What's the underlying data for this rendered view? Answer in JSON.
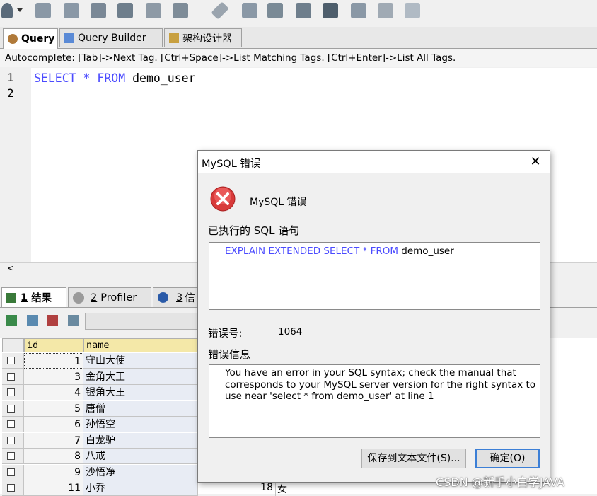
{
  "tabs": [
    {
      "label": "Query",
      "active": true
    },
    {
      "label": "Query Builder",
      "active": false
    },
    {
      "label": "架构设计器",
      "active": false
    }
  ],
  "autocomplete_hint": "Autocomplete: [Tab]->Next Tag. [Ctrl+Space]->List Matching Tags. [Ctrl+Enter]->List All Tags.",
  "editor": {
    "line_numbers": [
      "1",
      "2"
    ],
    "code": {
      "kw1": "SELECT",
      "star": "*",
      "kw2": "FROM",
      "table": "demo_user"
    }
  },
  "result_tabs": [
    {
      "num": "1",
      "label": "结果"
    },
    {
      "num": "2",
      "label": "Profiler"
    },
    {
      "num": "3",
      "label": "信"
    }
  ],
  "grid": {
    "columns": [
      "id",
      "name"
    ],
    "rows": [
      {
        "id": "1",
        "name": "守山大使"
      },
      {
        "id": "3",
        "name": "金角大王"
      },
      {
        "id": "4",
        "name": "银角大王"
      },
      {
        "id": "5",
        "name": "唐僧"
      },
      {
        "id": "6",
        "name": "孙悟空"
      },
      {
        "id": "7",
        "name": "白龙驴"
      },
      {
        "id": "8",
        "name": "八戒"
      },
      {
        "id": "9",
        "name": "沙悟净"
      },
      {
        "id": "11",
        "name": "小乔"
      }
    ],
    "partial_row": {
      "age": "18",
      "sex": "女"
    }
  },
  "dialog": {
    "title": "MySQL 错误",
    "heading": "MySQL 错误",
    "executed_label": "已执行的 SQL 语句",
    "sql": {
      "kw": "EXPLAIN EXTENDED SELECT",
      "star": "*",
      "kw2": "FROM",
      "table": "demo_user"
    },
    "errno_label": "错误号:",
    "errno": "1064",
    "errinfo_label": "错误信息",
    "errinfo": "You have an error in your SQL syntax; check the manual that corresponds to your MySQL server version for the right syntax to use near 'select * from demo_user' at line 1",
    "save_button": "保存到文本文件(S)...",
    "ok_button": "确定(O)",
    "close_glyph": "✕"
  },
  "watermark": "CSDN @新手小白学JAVA"
}
